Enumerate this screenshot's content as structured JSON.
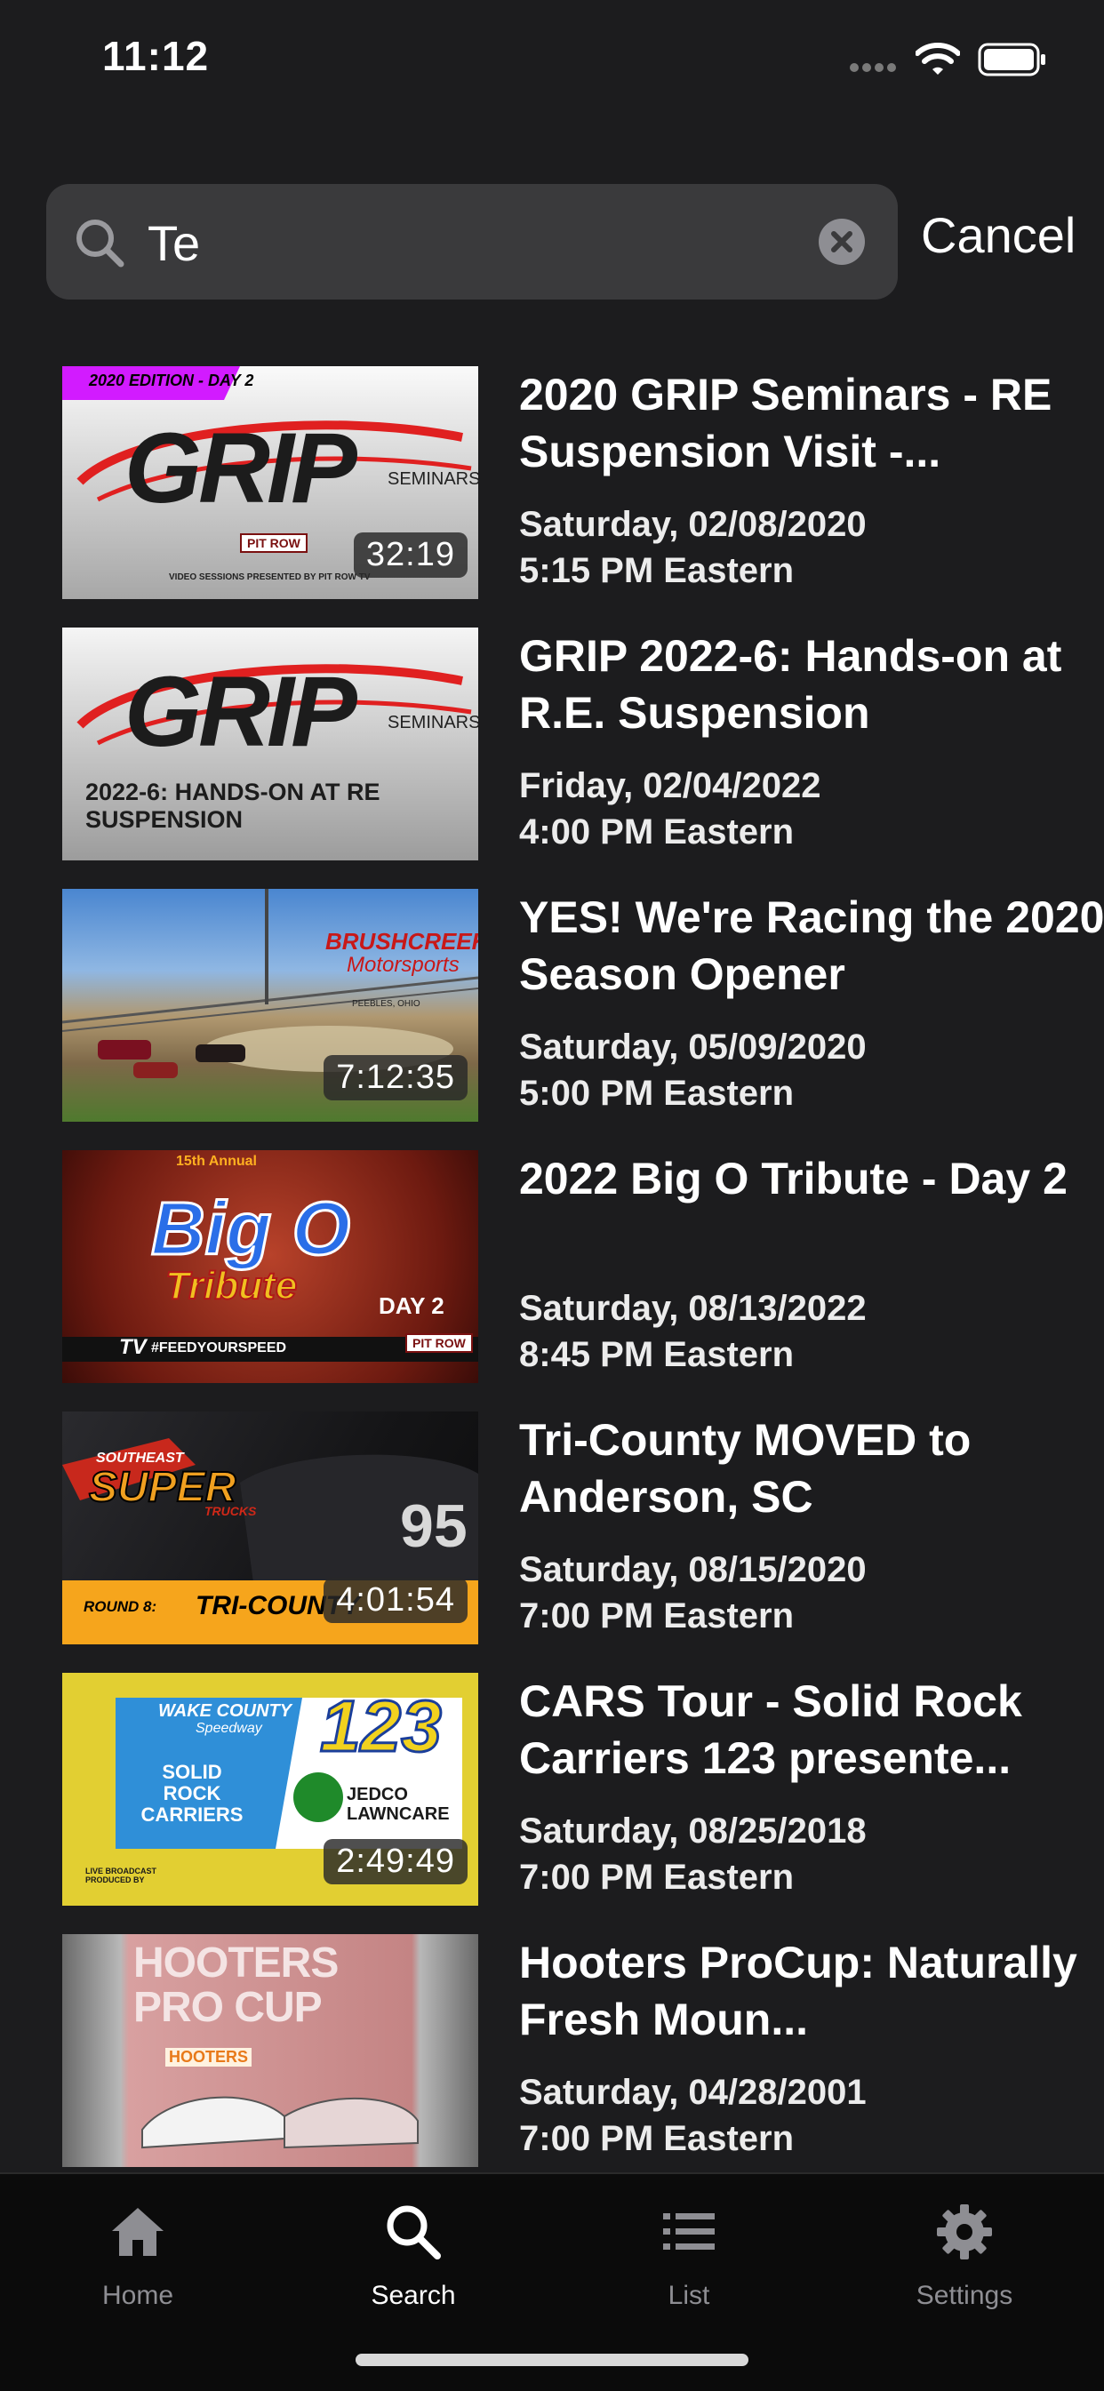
{
  "status_bar": {
    "time": "11:12"
  },
  "search": {
    "value": "Te",
    "cancel_label": "Cancel"
  },
  "results": [
    {
      "title": "2020 GRIP Seminars - RE Suspension Visit -...",
      "date": "Saturday, 02/08/2020",
      "time": "5:15 PM Eastern",
      "duration": "32:19",
      "thumb": {
        "banner": "2020 EDITION - DAY 2",
        "logo": "GRIP",
        "sub": "SEMINARS",
        "footer": "VIDEO SESSIONS PRESENTED BY PIT ROW TV",
        "badge": "PIT ROW"
      }
    },
    {
      "title": "GRIP 2022-6: Hands-on at R.E. Suspension",
      "date": "Friday, 02/04/2022",
      "time": "4:00 PM Eastern",
      "duration": "",
      "thumb": {
        "logo": "GRIP",
        "sub": "SEMINARS",
        "caption": "2022-6: HANDS-ON AT RE SUSPENSION"
      }
    },
    {
      "title": "YES! We're Racing the 2020 Season Opener",
      "date": "Saturday, 05/09/2020",
      "time": "5:00 PM Eastern",
      "duration": "7:12:35",
      "thumb": {
        "logo": "BRUSHCREEK",
        "sub": "Motorsports",
        "place": "PEEBLES, OHIO"
      }
    },
    {
      "title": "2022 Big O Tribute - Day 2",
      "date": "Saturday, 08/13/2022",
      "time": "8:45 PM Eastern",
      "duration": "",
      "thumb": {
        "top": "15th Annual",
        "logo": "Big O",
        "sub": "Tribute",
        "day": "DAY 2",
        "hashtag": "#FEEDYOURSPEED",
        "tv": "TV",
        "badge": "PIT ROW"
      }
    },
    {
      "title": "Tri-County MOVED to Anderson, SC",
      "date": "Saturday, 08/15/2020",
      "time": "7:00 PM Eastern",
      "duration": "4:01:54",
      "thumb": {
        "top": "SOUTHEAST",
        "logo": "SUPER",
        "sub": "TRUCKS",
        "round": "ROUND 8:",
        "track": "TRI-COUNTY",
        "number": "95"
      }
    },
    {
      "title": "CARS Tour - Solid Rock Carriers 123 presente...",
      "date": "Saturday, 08/25/2018",
      "time": "7:00 PM Eastern",
      "duration": "2:49:49",
      "thumb": {
        "top": "WAKE COUNTY",
        "sub": "Speedway",
        "number": "123",
        "sponsor1": "SOLID ROCK CARRIERS",
        "sponsor2": "JEDCO LAWNCARE",
        "footer": "LIVE BROADCAST PRODUCED BY"
      }
    },
    {
      "title": "Hooters ProCup: Naturally Fresh Moun...",
      "date": "Saturday, 04/28/2001",
      "time": "7:00 PM Eastern",
      "duration": "",
      "thumb": {
        "logo": "HOOTERS PRO CUP",
        "sub": "HOOTERS"
      }
    }
  ],
  "tab_bar": {
    "items": [
      {
        "label": "Home",
        "icon": "home-icon"
      },
      {
        "label": "Search",
        "icon": "search-icon"
      },
      {
        "label": "List",
        "icon": "list-icon"
      },
      {
        "label": "Settings",
        "icon": "gear-icon"
      }
    ],
    "active": "Search"
  }
}
